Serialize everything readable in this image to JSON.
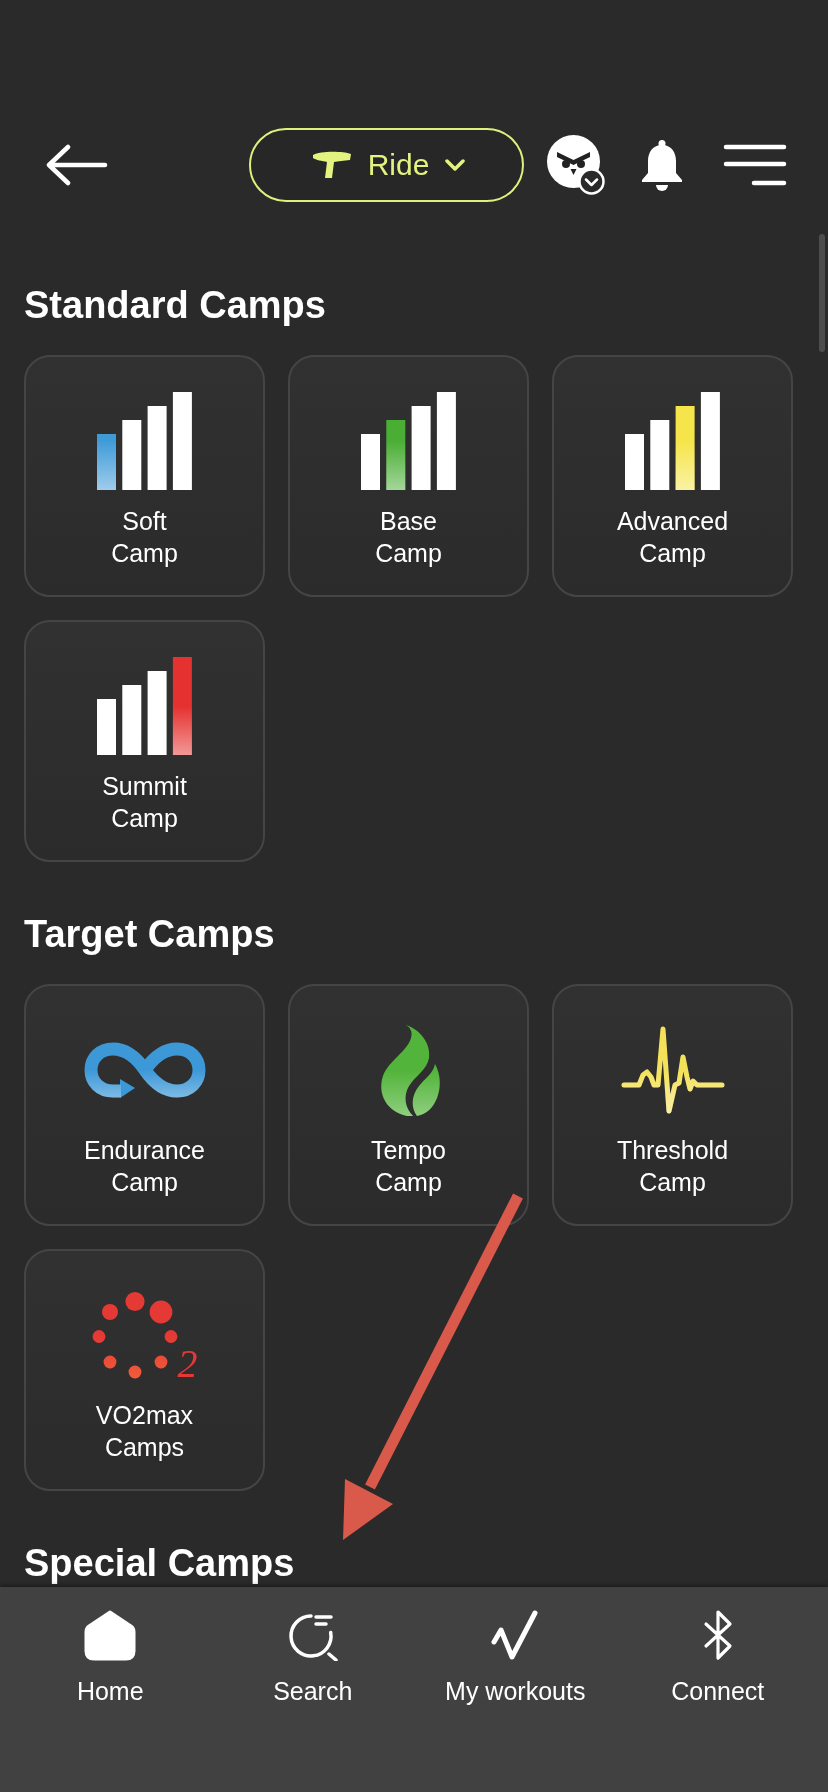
{
  "header": {
    "sport_selector": {
      "label": "Ride"
    }
  },
  "sections": [
    {
      "title": "Standard Camps",
      "camps": [
        {
          "kind": "bars",
          "name": "Soft Camp",
          "color": "#3f9bd8"
        },
        {
          "kind": "bars",
          "name": "Base Camp",
          "color": "#4aae35"
        },
        {
          "kind": "bars",
          "name": "Advanced Camp",
          "color": "#f5e54a"
        },
        {
          "kind": "bars",
          "name": "Summit Camp",
          "color": "#e5312f"
        }
      ]
    },
    {
      "title": "Target Camps",
      "camps": [
        {
          "kind": "infinity",
          "name": "Endurance Camp",
          "color": "#3d98d8"
        },
        {
          "kind": "flame",
          "name": "Tempo Camp",
          "color": "#52b43a"
        },
        {
          "kind": "pulse",
          "name": "Threshold Camp",
          "color": "#f4e15a"
        },
        {
          "kind": "dots",
          "name": "VO2max Camps",
          "color": "#e53935",
          "subscript": "2"
        }
      ]
    },
    {
      "title": "Special Camps"
    }
  ],
  "nav": [
    {
      "kind": "home",
      "label": "Home"
    },
    {
      "kind": "search",
      "label": "Search"
    },
    {
      "kind": "workouts",
      "label": "My workouts"
    },
    {
      "kind": "bluetooth",
      "label": "Connect"
    }
  ]
}
